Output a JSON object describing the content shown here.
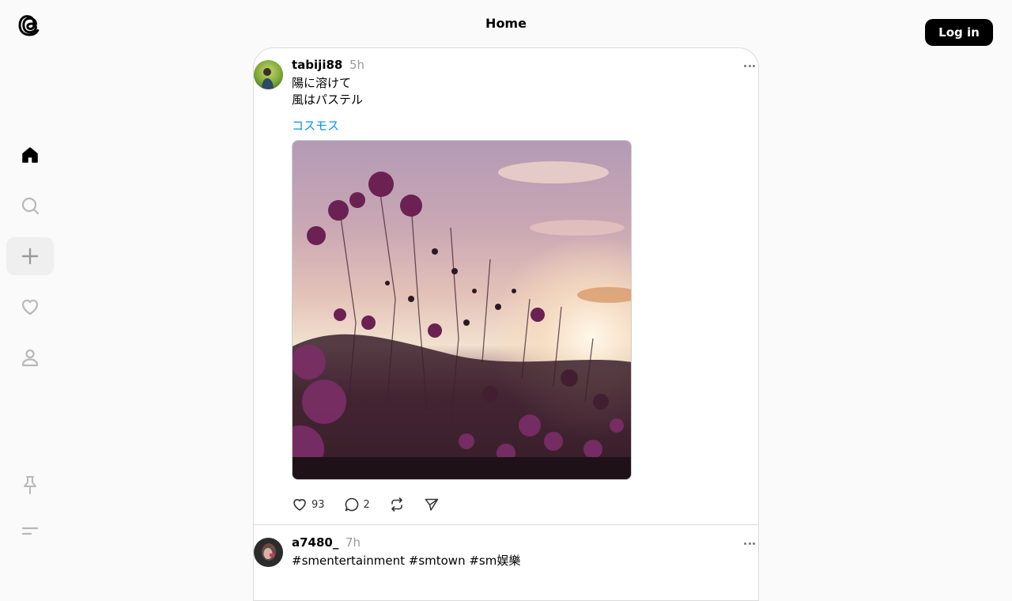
{
  "header": {
    "title": "Home",
    "login_label": "Log in"
  },
  "sidebar": {
    "items": [
      {
        "name": "home",
        "icon": "home-icon",
        "active": false
      },
      {
        "name": "search",
        "icon": "search-icon",
        "active": false
      },
      {
        "name": "create",
        "icon": "plus-icon",
        "active": true
      },
      {
        "name": "activity",
        "icon": "heart-icon",
        "active": false
      },
      {
        "name": "profile",
        "icon": "person-icon",
        "active": false
      },
      {
        "name": "pin",
        "icon": "pin-icon",
        "active": false
      },
      {
        "name": "menu",
        "icon": "menu-icon",
        "active": false
      }
    ]
  },
  "posts": [
    {
      "username": "tabiji88",
      "time": "5h",
      "lines": [
        "陽に溶けて",
        "風はパステル"
      ],
      "tag": "コスモス",
      "image": "cosmos-flowers-sunset",
      "likes": "93",
      "replies": "2"
    },
    {
      "username": "a7480_",
      "time": "7h",
      "lines": [
        "#smentertainment #smtown #sm娱樂"
      ]
    }
  ],
  "colors": {
    "accent_link": "#0095f6",
    "button_bg": "#000000",
    "background": "#fafafa"
  }
}
